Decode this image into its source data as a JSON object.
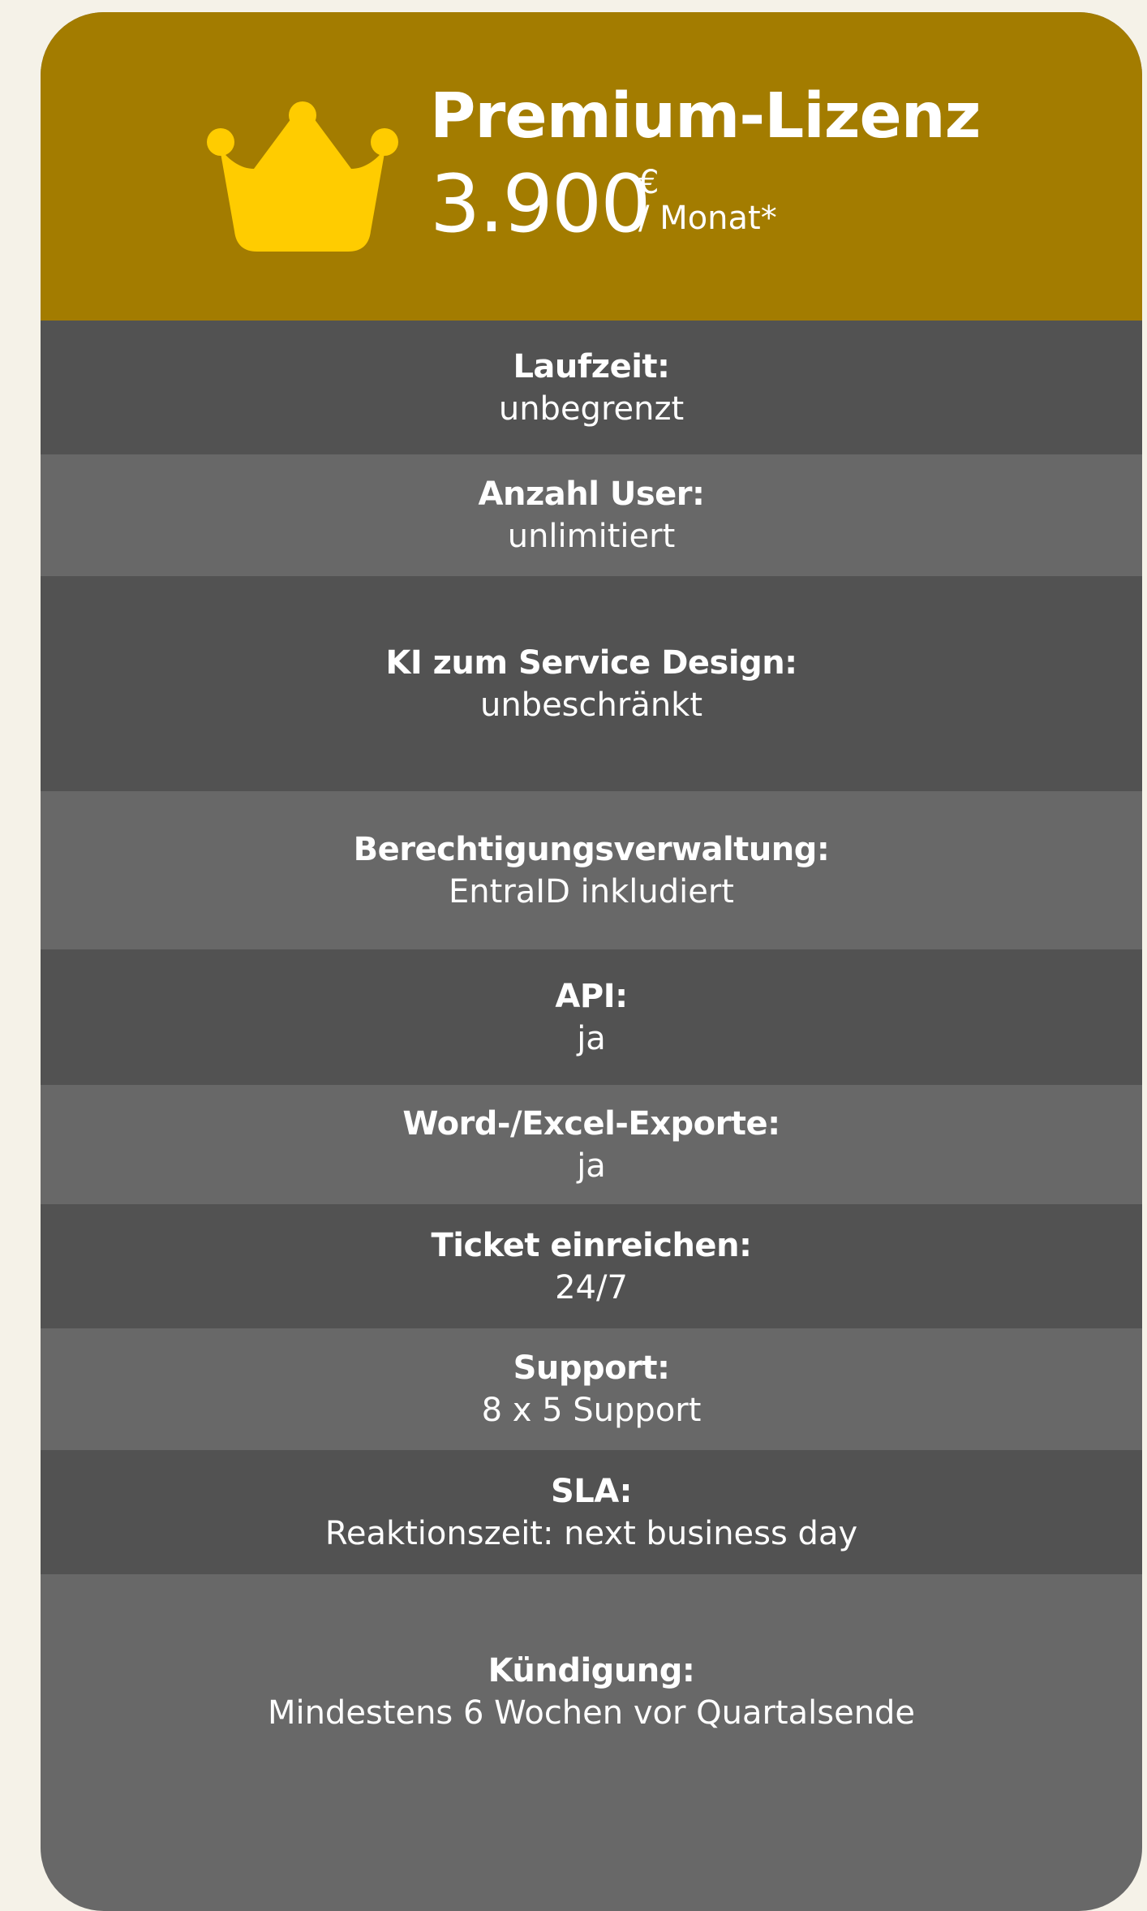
{
  "card": {
    "title": "Premium-Lizenz",
    "price": "3.900",
    "currency": "€",
    "period": "/ Monat*",
    "icon": "crown-icon",
    "colors": {
      "header": "#a37c00",
      "crown": "#ffcc00",
      "row_dark": "#525252",
      "row_light": "#686868",
      "page_background": "#f5f2e8"
    }
  },
  "features": [
    {
      "label": "Laufzeit:",
      "value": "unbegrenzt"
    },
    {
      "label": "Anzahl User:",
      "value": "unlimitiert"
    },
    {
      "label": "KI zum Service Design:",
      "value": "unbeschränkt"
    },
    {
      "label": "Berechtigungsverwaltung:",
      "value": "EntraID inkludiert"
    },
    {
      "label": "API:",
      "value": "ja"
    },
    {
      "label": "Word-/Excel-Exporte:",
      "value": "ja"
    },
    {
      "label": "Ticket einreichen:",
      "value": "24/7"
    },
    {
      "label": "Support:",
      "value": "8 x 5 Support"
    },
    {
      "label": "SLA:",
      "value": "Reaktionszeit: next business day"
    },
    {
      "label": "Kündigung:",
      "value": "Mindestens 6 Wochen vor Quartalsende"
    }
  ]
}
